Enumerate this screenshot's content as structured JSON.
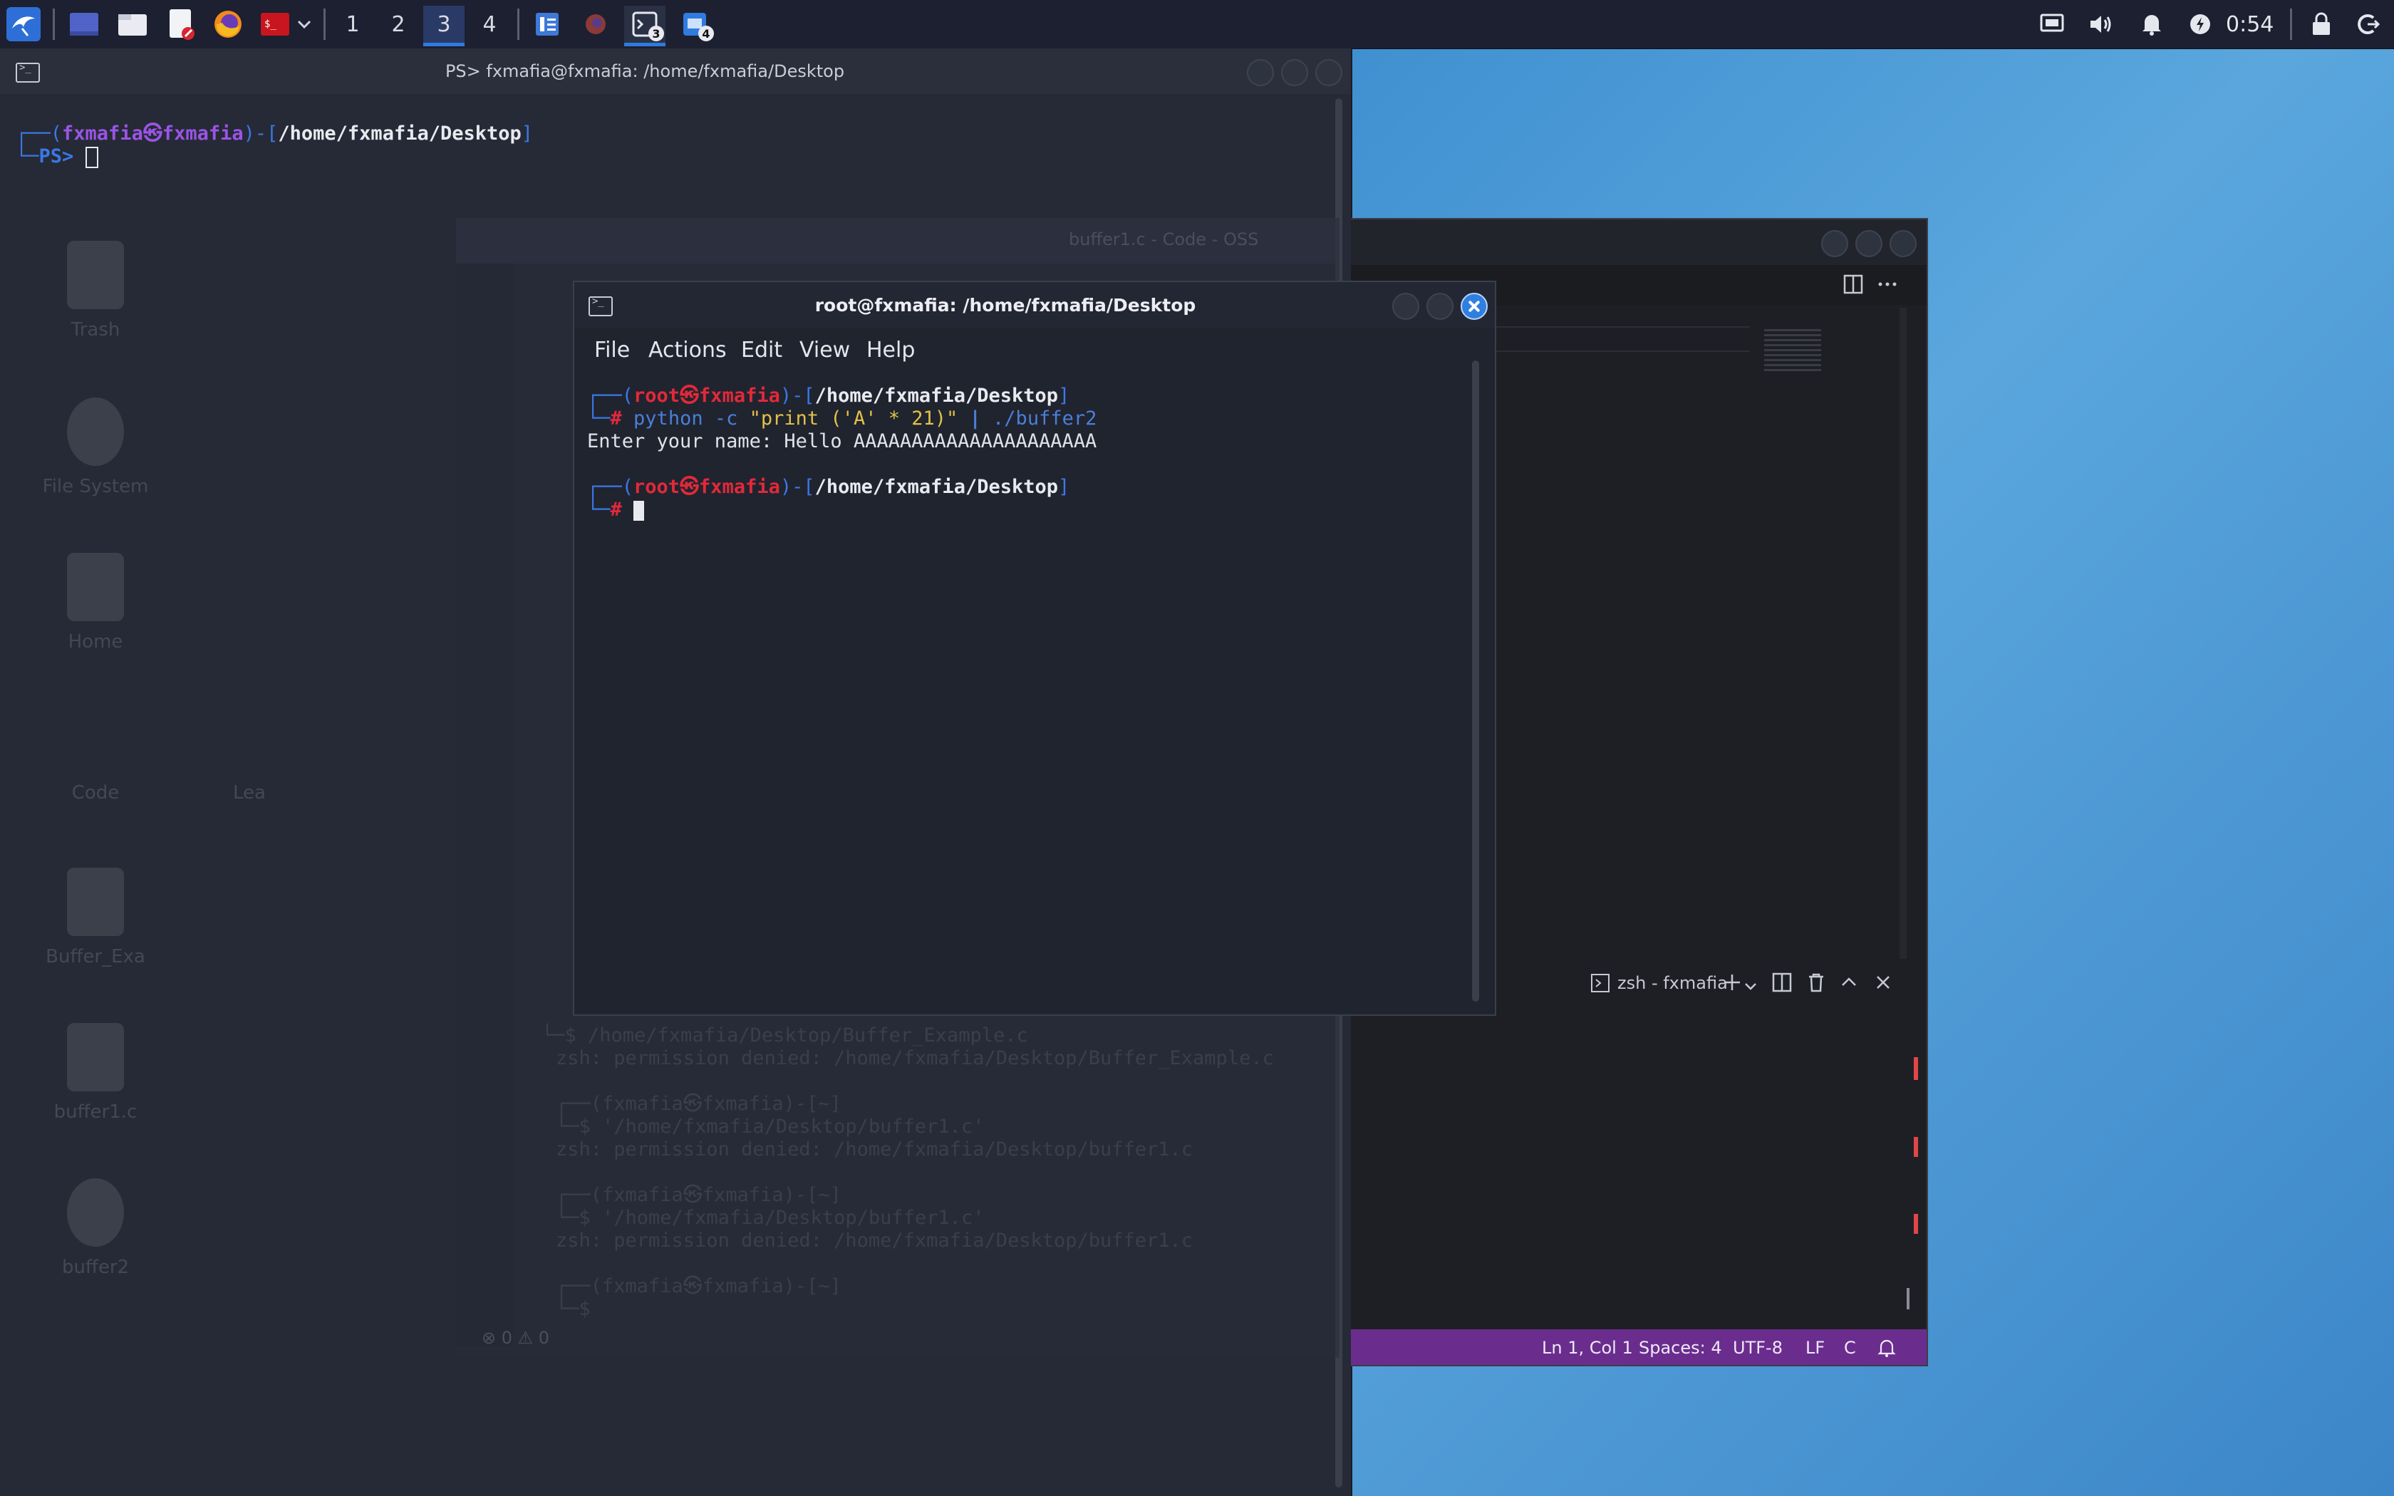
{
  "taskbar": {
    "workspaces": [
      "1",
      "2",
      "3",
      "4"
    ],
    "active_workspace": 3,
    "badges": {
      "terminal": "3",
      "vscode": "4"
    },
    "clock": "0:54"
  },
  "desktop_icons": [
    {
      "label": "Trash"
    },
    {
      "label": "File System"
    },
    {
      "label": "Home"
    },
    {
      "label": "Code"
    },
    {
      "label": "Lea"
    },
    {
      "label": "Buffer_Exa"
    },
    {
      "label": "buffer1.c"
    },
    {
      "label": "buffer2"
    }
  ],
  "ps_window": {
    "title": "PS> fxmafia@fxmafia: /home/fxmafia/Desktop",
    "prompt_open": "┌──(",
    "user": "fxmafia㉿fxmafia",
    "prompt_mid": ")-[",
    "path": "/home/fxmafia/Desktop",
    "prompt_close": "]",
    "prompt_line2": "└─PS> "
  },
  "ghost_terminal": {
    "lines": [
      "└─$ /home/fxmafia/Desktop/Buffer_Example.c",
      "zsh: permission denied: /home/fxmafia/Desktop/Buffer_Example.c",
      "",
      "┌──(fxmafia㉿fxmafia)-[~]",
      "└─$ '/home/fxmafia/Desktop/buffer1.c'",
      "zsh: permission denied: /home/fxmafia/Desktop/buffer1.c",
      "",
      "┌──(fxmafia㉿fxmafia)-[~]",
      "└─$ '/home/fxmafia/Desktop/buffer1.c'",
      "zsh: permission denied: /home/fxmafia/Desktop/buffer1.c",
      "",
      "┌──(fxmafia㉿fxmafia)-[~]",
      "└─$"
    ]
  },
  "root_window": {
    "title": "root@fxmafia: /home/fxmafia/Desktop",
    "menu": [
      "File",
      "Actions",
      "Edit",
      "View",
      "Help"
    ],
    "prompt_open": "┌──(",
    "user": "root㉿fxmafia",
    "prompt_mid": ")-[",
    "path": "/home/fxmafia/Desktop",
    "prompt_close": "]",
    "prompt_line2_prefix": "└─",
    "hash": "#",
    "cmd_python": "python",
    "cmd_flag": "-c",
    "cmd_string": "\"print ('A' * 21)\"",
    "cmd_pipe": "|",
    "cmd_target": "./buffer2",
    "output": "Enter your name: Hello AAAAAAAAAAAAAAAAAAAAA"
  },
  "vscode": {
    "ghost_title": "buffer1.c - Code - OSS",
    "terminal_tab": "zsh - fxmafia",
    "status": {
      "position": "Ln 1, Col 1",
      "spaces": "Spaces: 4",
      "encoding": "UTF-8",
      "eol": "LF",
      "language": "C"
    },
    "ghost_status": "⊗ 0 ⚠ 0"
  }
}
